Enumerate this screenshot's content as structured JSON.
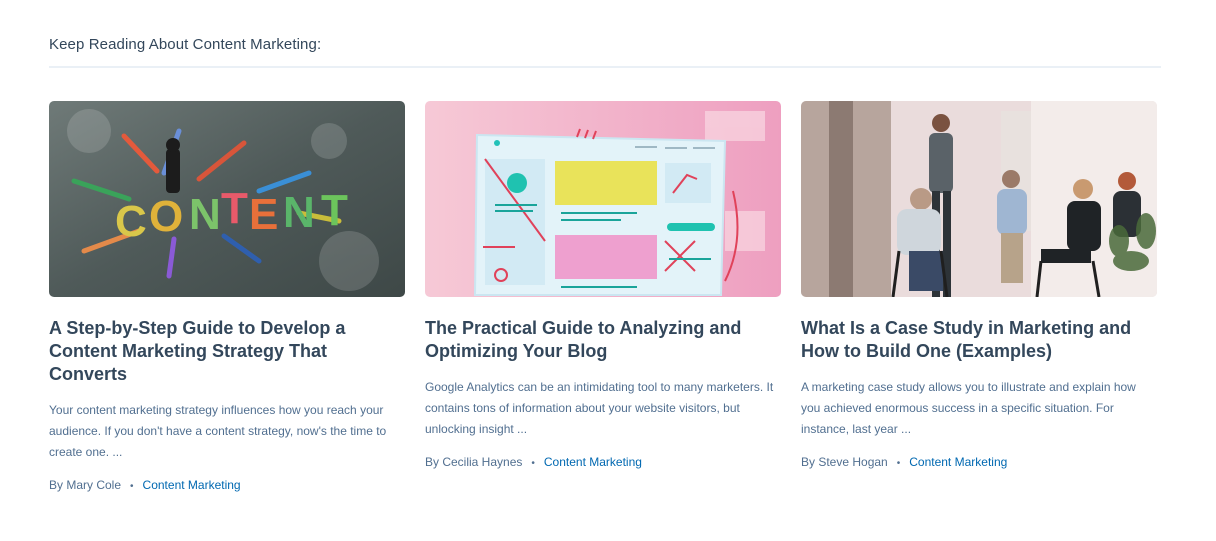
{
  "section": {
    "heading": "Keep Reading About Content Marketing:"
  },
  "colors": {
    "link": "#0068b1",
    "title": "#33475b",
    "body": "#516f90",
    "divider": "#eaf0f6"
  },
  "cards": [
    {
      "image": "content-scrabble-letters-with-arrows",
      "title": "A Step-by-Step Guide to Develop a Content Marketing Strategy That Converts",
      "excerpt": "Your content marketing strategy influences how you reach your audience. If you don't have a content strategy, now's the time to create one. ...",
      "author": "By Mary Cole",
      "bullet": "•",
      "category": "Content Marketing"
    },
    {
      "image": "blog-analytics-illustration",
      "title": "The Practical Guide to Analyzing and Optimizing Your Blog",
      "excerpt": "Google Analytics can be an intimidating tool to many marketers. It contains tons of information about your website visitors, but unlocking insight ...",
      "author": "By Cecilia Haynes",
      "bullet": "•",
      "category": "Content Marketing"
    },
    {
      "image": "team-meeting-photo",
      "title": "What Is a Case Study in Marketing and How to Build One (Examples)",
      "excerpt": "A marketing case study allows you to illustrate and explain how you achieved enormous success in a specific situation. For instance, last year ...",
      "author": "By Steve Hogan",
      "bullet": "•",
      "category": "Content Marketing"
    }
  ]
}
